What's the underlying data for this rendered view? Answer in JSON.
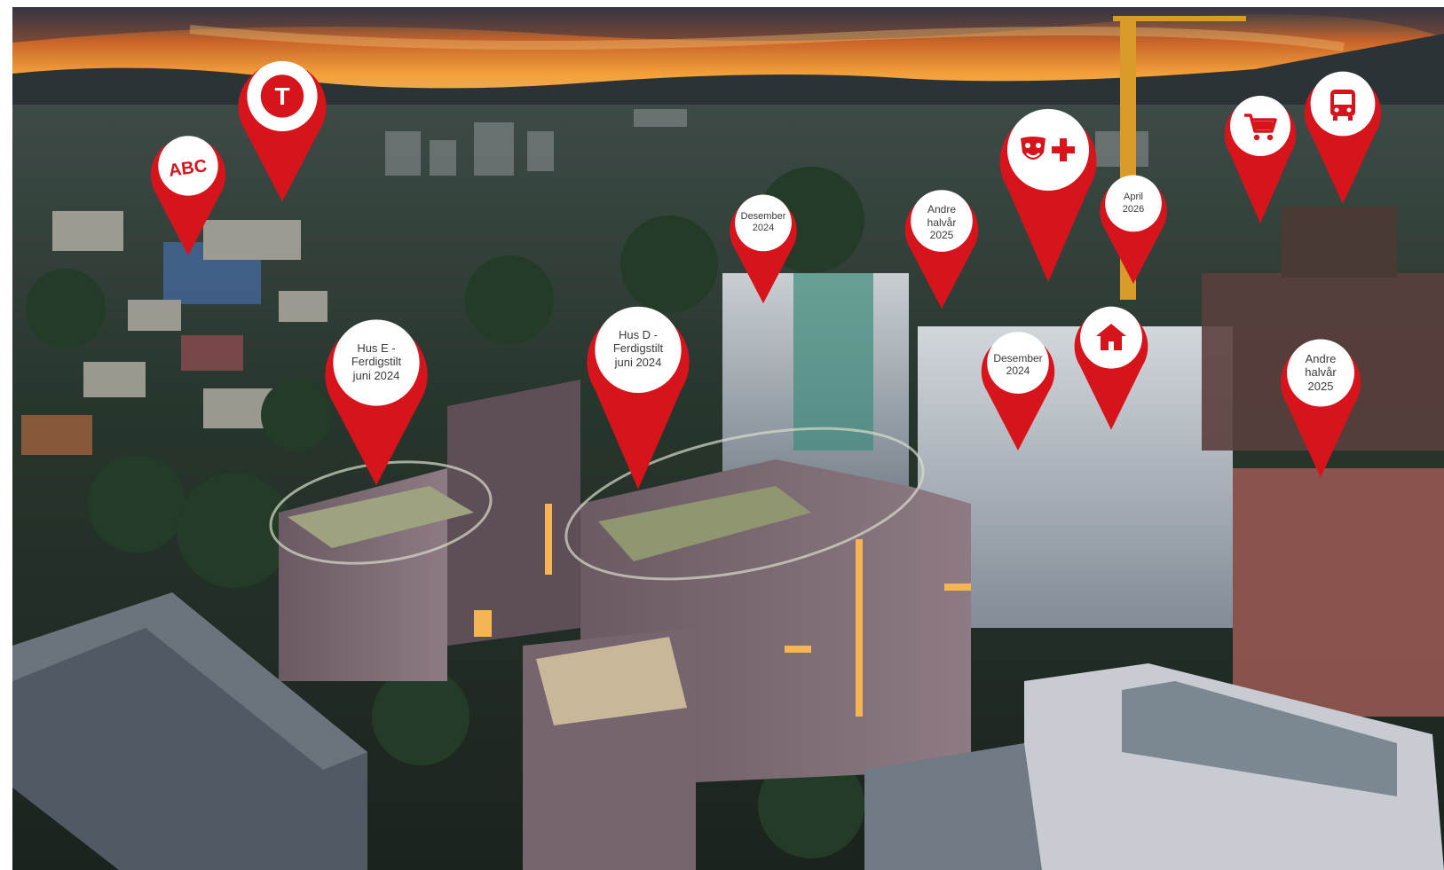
{
  "scene": {
    "description_colors": {
      "sky_top": "#1e2f3e",
      "sunset": "#f3a23a",
      "marker_red": "#d7141c",
      "marker_white": "#ffffff"
    }
  },
  "markers": [
    {
      "id": "school",
      "icon": "abc-school-icon",
      "label": "ABC"
    },
    {
      "id": "metro",
      "icon": "t-bane-metro-icon",
      "label": "T"
    },
    {
      "id": "hus-e",
      "label": "Hus E -\nFerdigstilt\njuni 2024"
    },
    {
      "id": "hus-d",
      "label": "Hus D -\nFerdigstilt\njuni 2024"
    },
    {
      "id": "desember-2024-a",
      "label": "Desember\n2024"
    },
    {
      "id": "andre-halvar-2025-a",
      "label": "Andre\nhalvår\n2025"
    },
    {
      "id": "culture-health",
      "icon": "theater-mask-plus-icon"
    },
    {
      "id": "april-2026",
      "label": "April\n2026"
    },
    {
      "id": "shopping",
      "icon": "shopping-cart-icon"
    },
    {
      "id": "bus",
      "icon": "bus-icon"
    },
    {
      "id": "desember-2024-b",
      "label": "Desember\n2024"
    },
    {
      "id": "home",
      "icon": "house-icon"
    },
    {
      "id": "andre-halvar-2025-b",
      "label": "Andre\nhalvår\n2025"
    }
  ]
}
